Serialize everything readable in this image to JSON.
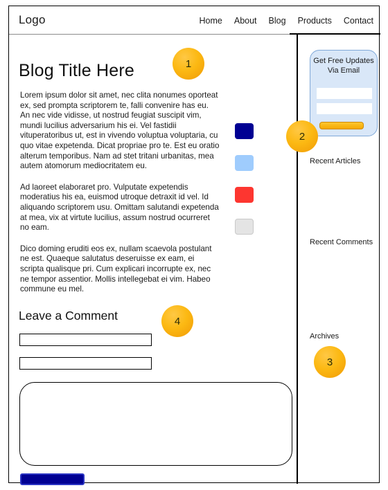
{
  "header": {
    "logo": "Logo",
    "nav": [
      {
        "label": "Home",
        "active": false
      },
      {
        "label": "About",
        "active": false
      },
      {
        "label": "Blog",
        "active": false
      },
      {
        "label": "Products",
        "active": true
      },
      {
        "label": "Contact",
        "active": false
      }
    ]
  },
  "article": {
    "title": "Blog Title Here",
    "paragraphs": [
      "Lorem ipsum dolor sit amet, nec clita nonumes oporteat ex, sed prompta scriptorem te, falli convenire has eu. An nec vide vidisse, ut nostrud feugiat suscipit vim, mundi lucilius adversarium his ei. Vel fastidii vituperatoribus ut, est in vivendo voluptua voluptaria, cu quo vitae expetenda. Dicat propriae pro te. Est eu oratio alterum temporibus. Nam ad stet tritani urbanitas, mea autem atomorum mediocritatem eu.",
      "Ad laoreet elaboraret pro. Vulputate expetendis moderatius his ea, euismod utroque detraxit id vel. Id aliquando scriptorem usu. Omittam salutandi expetenda at mea, vix at virtute lucilius, assum nostrud ocurreret no eam.",
      "Dico doming eruditi eos ex, nullam scaevola postulant ne est. Quaeque salutatus deseruisse ex eam, ei scripta qualisque pri. Cum explicari incorrupte ex, nec ne tempor assentior. Mollis intellegebat ei vim. Habeo commune eu mel."
    ]
  },
  "swatches": [
    {
      "name": "swatch-navy",
      "color": "#000093"
    },
    {
      "name": "swatch-light-blue",
      "color": "#9FCCFD"
    },
    {
      "name": "swatch-red",
      "color": "#FD3630"
    },
    {
      "name": "swatch-light-gray",
      "color": "#E4E4E4"
    }
  ],
  "comment_form": {
    "heading": "Leave a Comment",
    "name_value": "",
    "name_placeholder": "",
    "email_value": "",
    "email_placeholder": "",
    "message_value": "",
    "message_placeholder": "",
    "submit_label": "",
    "submit_color": "#000093"
  },
  "sidebar": {
    "signup": {
      "title": "Get Free Updates Via Email",
      "field1_value": "",
      "field1_placeholder": "",
      "field2_value": "",
      "field2_placeholder": "",
      "button_label": "",
      "button_color": "#F5A800",
      "panel_color": "#D9E7F8"
    },
    "sections": [
      {
        "label": "Recent Articles"
      },
      {
        "label": "Recent Comments"
      },
      {
        "label": "Archives"
      }
    ]
  },
  "markers": [
    {
      "number": "1"
    },
    {
      "number": "2"
    },
    {
      "number": "3"
    },
    {
      "number": "4"
    }
  ]
}
